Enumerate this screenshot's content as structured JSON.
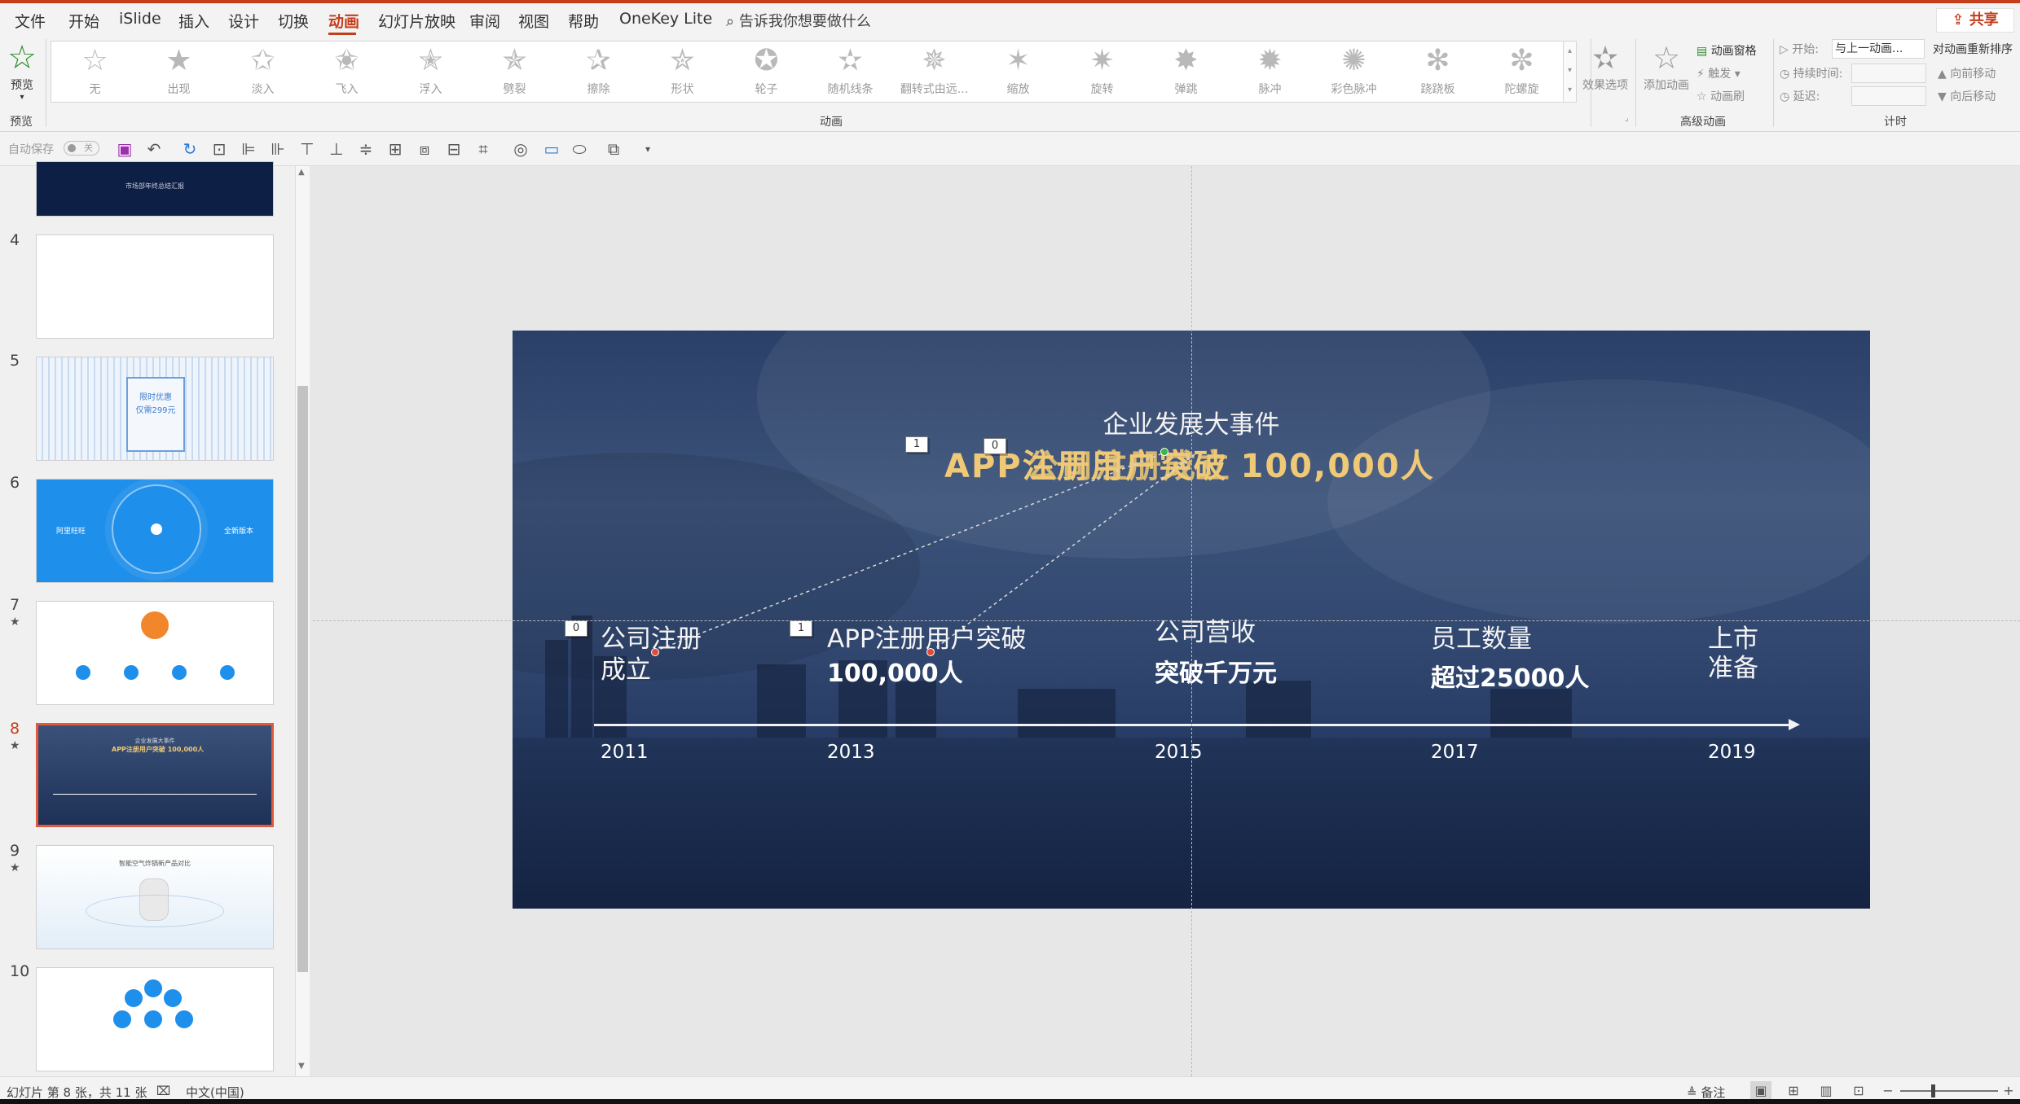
{
  "menu": {
    "file": "文件",
    "home": "开始",
    "islide": "iSlide",
    "insert": "插入",
    "design": "设计",
    "transitions": "切换",
    "animations": "动画",
    "slideshow": "幻灯片放映",
    "review": "审阅",
    "view": "视图",
    "help": "帮助",
    "onekey": "OneKey Lite",
    "search_placeholder": "告诉我你想要做什么",
    "share": "共享"
  },
  "ribbon": {
    "preview_label": "预览",
    "preview_group": "预览",
    "animation_group": "动画",
    "effects": [
      "无",
      "出现",
      "淡入",
      "飞入",
      "浮入",
      "劈裂",
      "擦除",
      "形状",
      "轮子",
      "随机线条",
      "翻转式由远...",
      "缩放",
      "旋转",
      "弹跳",
      "脉冲",
      "彩色脉冲",
      "跷跷板",
      "陀螺旋"
    ],
    "effect_options": "效果选项",
    "add_animation": "添加动画",
    "advanced_group": "高级动画",
    "animation_pane": "动画窗格",
    "trigger": "触发",
    "animation_painter": "动画刷",
    "timing_group": "计时",
    "start_label": "开始:",
    "start_value": "与上一动画...",
    "duration_label": "持续时间:",
    "delay_label": "延迟:",
    "reorder_title": "对动画重新排序",
    "move_earlier": "向前移动",
    "move_later": "向后移动"
  },
  "qat": {
    "autosave": "自动保存",
    "toggle": "关"
  },
  "thumbnails": [
    {
      "num": "4",
      "star": ""
    },
    {
      "num": "5",
      "star": ""
    },
    {
      "num": "6",
      "star": ""
    },
    {
      "num": "7",
      "star": "★"
    },
    {
      "num": "8",
      "star": "★"
    },
    {
      "num": "9",
      "star": "★"
    },
    {
      "num": "10",
      "star": ""
    }
  ],
  "thumb_text": {
    "t3": "市场部年终总结汇报",
    "t5a": "限时优惠",
    "t5b": "仅需299元",
    "t6a": "阿里旺旺",
    "t6b": "全新版本",
    "t9": "智能空气炸锅新产品对比"
  },
  "slide": {
    "title": "企业发展大事件",
    "gold_a": "APP注册用户突破 100,000人",
    "gold_b": "公司注册成立",
    "tags": [
      "1",
      "0",
      "0",
      "1"
    ],
    "events": [
      {
        "line1": "公司注册",
        "line2": "成立",
        "year": "2011"
      },
      {
        "line1": "APP注册用户突破",
        "line2": "100,000人",
        "year": "2013"
      },
      {
        "line1": "公司营收",
        "line2": "突破千万元",
        "year": "2015"
      },
      {
        "line1": "员工数量",
        "line2": "超过25000人",
        "year": "2017"
      },
      {
        "line1": "上市",
        "line2": "准备",
        "year": "2019"
      }
    ]
  },
  "status": {
    "slide_info": "幻灯片 第 8 张，共 11 张",
    "language": "中文(中国)",
    "notes": "备注"
  }
}
